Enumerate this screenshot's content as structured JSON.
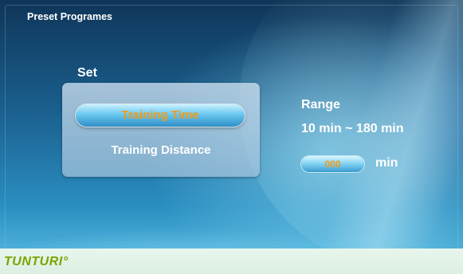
{
  "header": {
    "title": "Preset Programes"
  },
  "set": {
    "label": "Set",
    "options": [
      {
        "label": "Training Time",
        "selected": true
      },
      {
        "label": "Training Distance",
        "selected": false
      }
    ]
  },
  "range": {
    "label": "Range",
    "value": "10 min ~ 180 min"
  },
  "input": {
    "value": "000",
    "unit": "min"
  },
  "footer": {
    "brand": "TUNTURI°"
  },
  "colors": {
    "accent_text": "#f49a18",
    "brand_green": "#7aa400",
    "background_blue": "#1a5f8e"
  }
}
